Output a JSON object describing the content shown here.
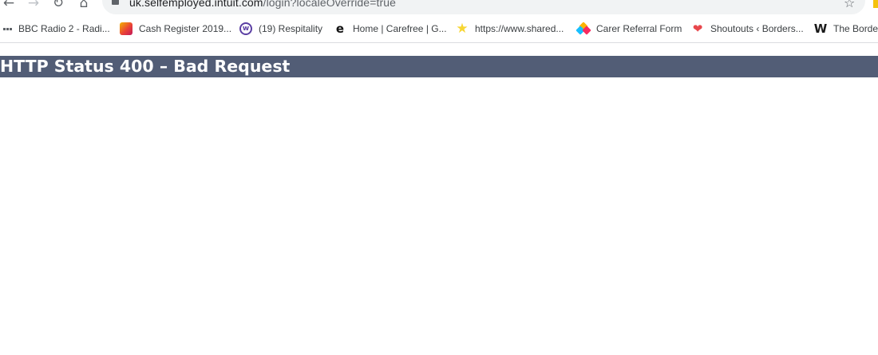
{
  "toolbar": {
    "back_icon": "arrow-left-icon",
    "forward_icon": "arrow-right-icon",
    "reload_icon": "reload-icon",
    "home_icon": "home-icon",
    "url_host": "uk.selfemployed.intuit.com",
    "url_path": "/login?localeOverride=true",
    "bookmark_star_icon": "star-outline-icon"
  },
  "bookmarks": {
    "items": [
      {
        "label": "BBC Radio 2 - Radi...",
        "icon": "apps-grid-icon"
      },
      {
        "label": "Cash Register 2019...",
        "icon": "cash-register-favicon"
      },
      {
        "label": "(19) Respitality",
        "icon": "respitality-favicon"
      },
      {
        "label": "Home | Carefree | G...",
        "icon": "carefree-favicon"
      },
      {
        "label": "https://www.shared...",
        "icon": "star-favicon"
      },
      {
        "label": "Carer Referral Form",
        "icon": "airtable-favicon"
      },
      {
        "label": "Shoutouts ‹ Borders...",
        "icon": "shoutouts-favicon"
      },
      {
        "label": "The Border",
        "icon": "weebly-favicon"
      }
    ]
  },
  "page": {
    "heading": "HTTP Status 400 – Bad Request"
  },
  "colors": {
    "header_bg": "#525d76",
    "header_text": "#ffffff",
    "omnibox_bg": "#f1f3f4"
  }
}
